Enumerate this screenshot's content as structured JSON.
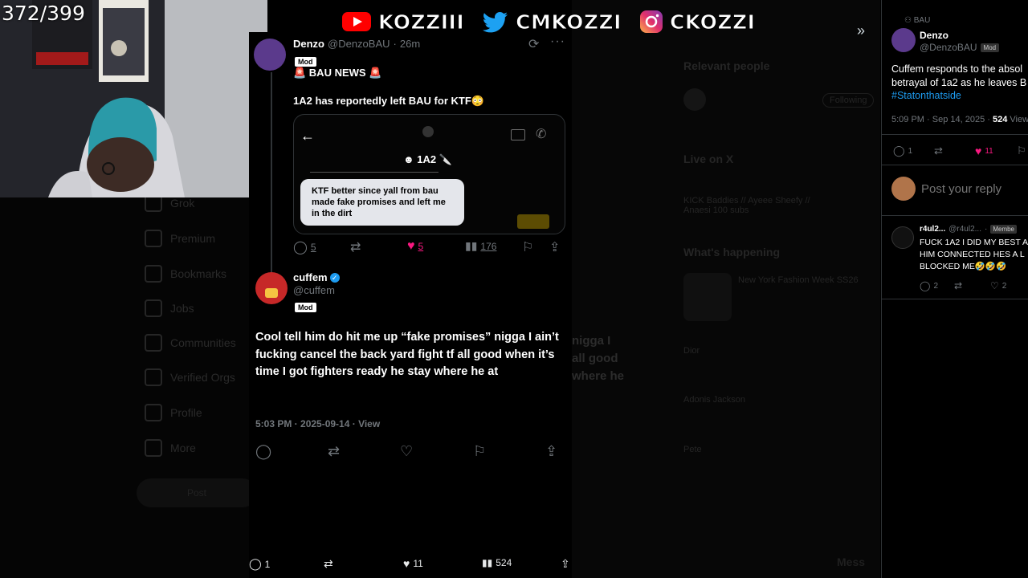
{
  "stream": {
    "counter": "372/399"
  },
  "socials": [
    {
      "platform": "youtube",
      "icon": "youtube-icon",
      "handle": "KOZZIII",
      "color": "#ff0000"
    },
    {
      "platform": "twitter",
      "icon": "twitter-icon",
      "handle": "CMKOZZI",
      "color": "#1da1f2"
    },
    {
      "platform": "instagram",
      "icon": "instagram-icon",
      "handle": "CKOZZI",
      "color": "#d6249f"
    }
  ],
  "background": {
    "nav": [
      "Grok",
      "Premium",
      "Bookmarks",
      "Jobs",
      "Communities",
      "Verified Orgs",
      "Profile",
      "More"
    ],
    "post_button": "Post",
    "relevant_people": "Relevant people",
    "follow_button": "Following",
    "live_on_x": "Live on X",
    "live_text": "KICK Baddies // Ayeee Sheefy // Anaesi 100 subs",
    "whats_happening": "What's happening",
    "trend": "New York Fashion Week SS26",
    "trend_names": [
      "Dior",
      "Adonis Jackson",
      "Pete"
    ],
    "messages": "Mess",
    "echo_text": [
      "nigga I",
      "all good",
      "where he"
    ]
  },
  "modal": {
    "quoted": {
      "name": "Denzo",
      "handle": "@DenzoBAU",
      "time": "26m",
      "badge": "Mod",
      "headline": "🚨 BAU NEWS 🚨",
      "text": "1A2 has reportedly left BAU for KTF😳",
      "dm": {
        "contact": "1A2",
        "message": "KTF better since yall from bau made fake promises and left me in the dirt"
      },
      "stats": {
        "replies": "5",
        "likes": "5",
        "views": "176"
      }
    },
    "reply": {
      "name": "cuffem",
      "handle": "@cuffem",
      "badge": "Mod",
      "text": "Cool tell him do hit me up “fake promises” nigga I ain’t fucking cancel the back yard fight tf all good when it’s time I got fighters ready he stay where he at",
      "meta": "5:03 PM · 2025-09-14 · View"
    },
    "bottom_stats": {
      "replies": "1",
      "likes": "11",
      "views": "524"
    }
  },
  "right": {
    "community": "BAU",
    "author": {
      "name": "Denzo",
      "handle": "@DenzoBAU",
      "badge": "Mod"
    },
    "text": "Cuffem responds to the absol betrayal of 1a2 as he leaves B",
    "hashtag": "#Statonthatside",
    "time": "5:09 PM · Sep 14, 2025 · ",
    "views": "524",
    "views_label": "View",
    "stats": {
      "replies": "1",
      "likes": "11"
    },
    "reply_placeholder": "Post your reply",
    "comment": {
      "name": "r4ul2...",
      "handle": "@r4ul2...",
      "badge": "Membe",
      "text": "FUCK 1A2 I DID MY BEST A HIM CONNECTED HES A L BLOCKED ME🤣🤣🤣",
      "replies": "2",
      "likes": "2"
    }
  }
}
